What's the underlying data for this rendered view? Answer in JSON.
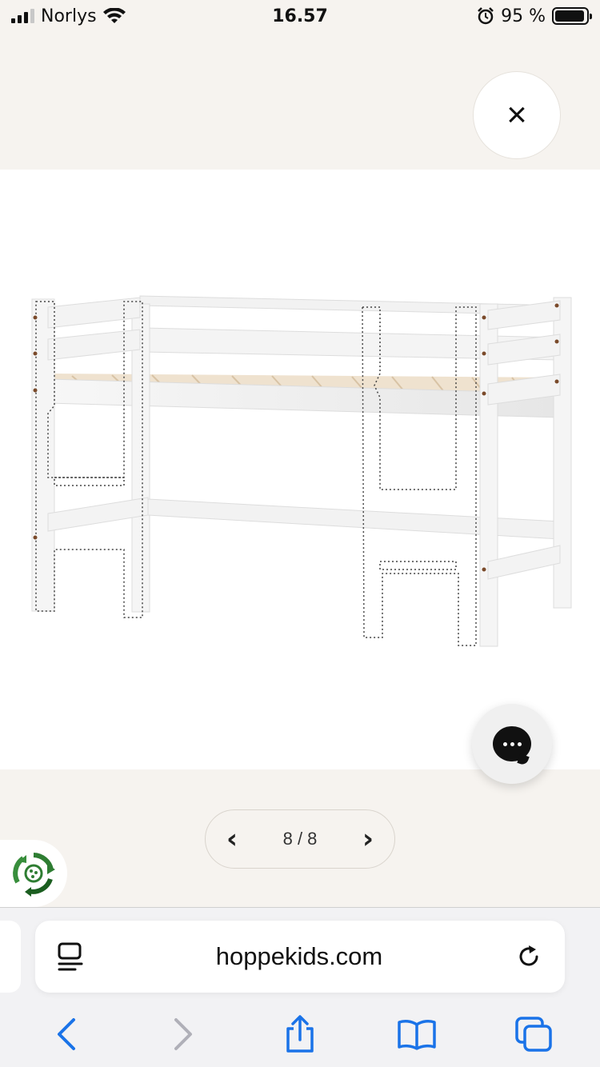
{
  "status_bar": {
    "carrier": "Norlys",
    "time": "16.57",
    "battery_percent": "95 %",
    "battery_level": 0.95
  },
  "viewer": {
    "close_label": "×",
    "pager": {
      "prev_label": "‹",
      "count": "8 / 8",
      "next_label": "›"
    },
    "chat_icon": "chat-bubble-icon",
    "eco_icon": "recycle-icon"
  },
  "browser": {
    "url": "hoppekids.com",
    "toolbar": [
      "back-icon",
      "forward-icon",
      "share-icon",
      "bookmarks-icon",
      "tabs-icon"
    ],
    "colors": {
      "accent": "#1a73e8",
      "disabled": "#b0b0b8"
    }
  }
}
